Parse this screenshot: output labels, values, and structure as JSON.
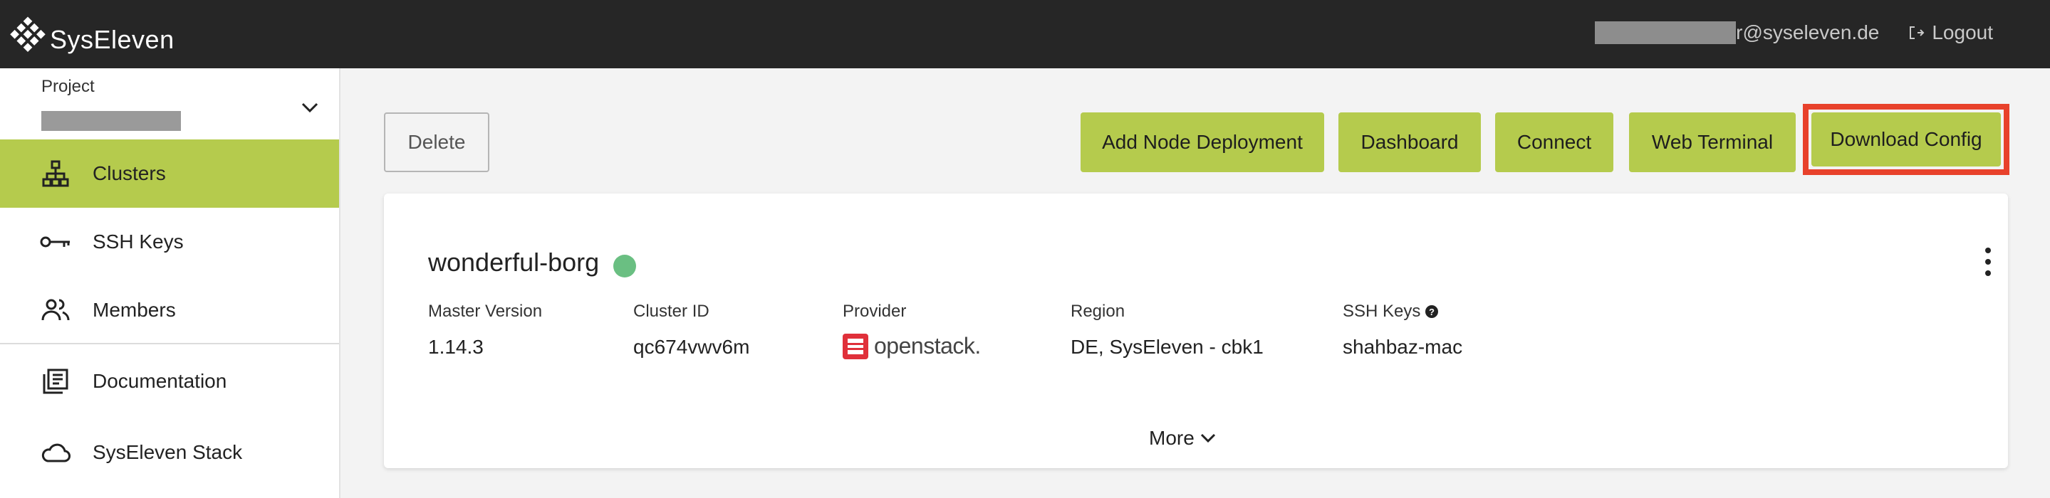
{
  "header": {
    "brand": "SysEleven",
    "user_email_visible": "r@syseleven.de",
    "logout_label": "Logout"
  },
  "sidebar": {
    "project_label": "Project",
    "items": [
      {
        "label": "Clusters",
        "icon": "sitemap-icon",
        "active": true
      },
      {
        "label": "SSH Keys",
        "icon": "key-icon",
        "active": false
      },
      {
        "label": "Members",
        "icon": "users-icon",
        "active": false
      },
      {
        "label": "Documentation",
        "icon": "library-books-icon",
        "active": false
      },
      {
        "label": "SysEleven Stack",
        "icon": "cloud-icon",
        "active": false
      }
    ]
  },
  "toolbar": {
    "delete_label": "Delete",
    "add_node_label": "Add Node Deployment",
    "dashboard_label": "Dashboard",
    "connect_label": "Connect",
    "web_terminal_label": "Web Terminal",
    "download_config_label": "Download Config"
  },
  "cluster": {
    "name": "wonderful-borg",
    "status_color": "#6abf82",
    "labels": {
      "master_version": "Master Version",
      "cluster_id": "Cluster ID",
      "provider": "Provider",
      "region": "Region",
      "ssh_keys": "SSH Keys"
    },
    "values": {
      "master_version": "1.14.3",
      "cluster_id": "qc674vwv6m",
      "provider": "openstack.",
      "region": "DE, SysEleven - cbk1",
      "ssh_keys": "shahbaz-mac"
    },
    "more_label": "More"
  },
  "colors": {
    "accent": "#b5cb4d",
    "topbar": "#262626",
    "highlight": "#e8412b"
  }
}
